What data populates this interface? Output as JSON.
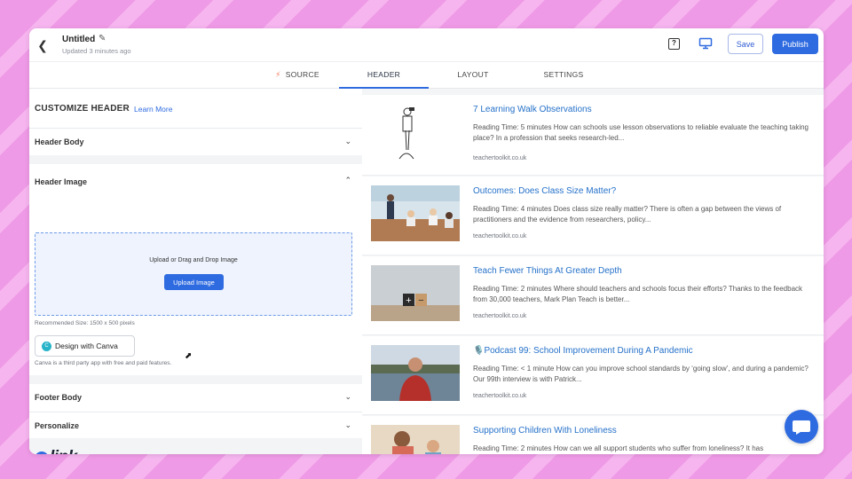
{
  "topbar": {
    "title": "Untitled",
    "updated": "Updated 3 minutes ago",
    "help_label": "?",
    "save_label": "Save",
    "publish_label": "Publish"
  },
  "tabs": [
    {
      "label": "SOURCE",
      "active": false
    },
    {
      "label": "HEADER",
      "active": true
    },
    {
      "label": "LAYOUT",
      "active": false
    },
    {
      "label": "SETTINGS",
      "active": false
    }
  ],
  "panel": {
    "title": "CUSTOMIZE HEADER",
    "learn_more": "Learn More",
    "sections": {
      "header_body": "Header Body",
      "header_image": "Header Image",
      "footer_body": "Footer Body",
      "personalize": "Personalize"
    },
    "upload": {
      "text": "Upload or Drag and Drop Image",
      "button": "Upload Image",
      "recommended": "Recommended Size: 1500 x 500 pixels"
    },
    "canva": {
      "button": "Design with Canva",
      "icon_letter": "C",
      "note": "Canva is a third party app with free and paid features."
    },
    "logo": {
      "e": "e",
      "rest": "link"
    }
  },
  "articles": [
    {
      "title": "7 Learning Walk Observations",
      "desc": "Reading Time: 5 minutes How can schools use lesson observations to reliable evaluate the teaching taking place? In a profession that seeks research-led...",
      "source": "teachertoolkit.co.uk"
    },
    {
      "title": "Outcomes: Does Class Size Matter?",
      "desc": "Reading Time: 4 minutes Does class size really matter? There is often a gap between the views of practitioners and the evidence from researchers, policy...",
      "source": "teachertoolkit.co.uk"
    },
    {
      "title": "Teach Fewer Things At Greater Depth",
      "desc": "Reading Time: 2 minutes Where should teachers and schools focus their efforts? Thanks to the feedback from 30,000 teachers, Mark Plan Teach is better...",
      "source": "teachertoolkit.co.uk"
    },
    {
      "title": "🎙️Podcast 99: School Improvement During A Pandemic",
      "desc": "Reading Time: < 1 minute How can you improve school standards by ‘going slow’, and during a pandemic? Our 99th interview is with Patrick...",
      "source": "teachertoolkit.co.uk"
    },
    {
      "title": "Supporting Children With Loneliness",
      "desc": "Reading Time: 2 minutes How can we all support students who suffer from loneliness? It has",
      "source": ""
    }
  ],
  "colors": {
    "accent": "#2f6be0",
    "link": "#2571c9",
    "background": "#ef9ae6"
  }
}
